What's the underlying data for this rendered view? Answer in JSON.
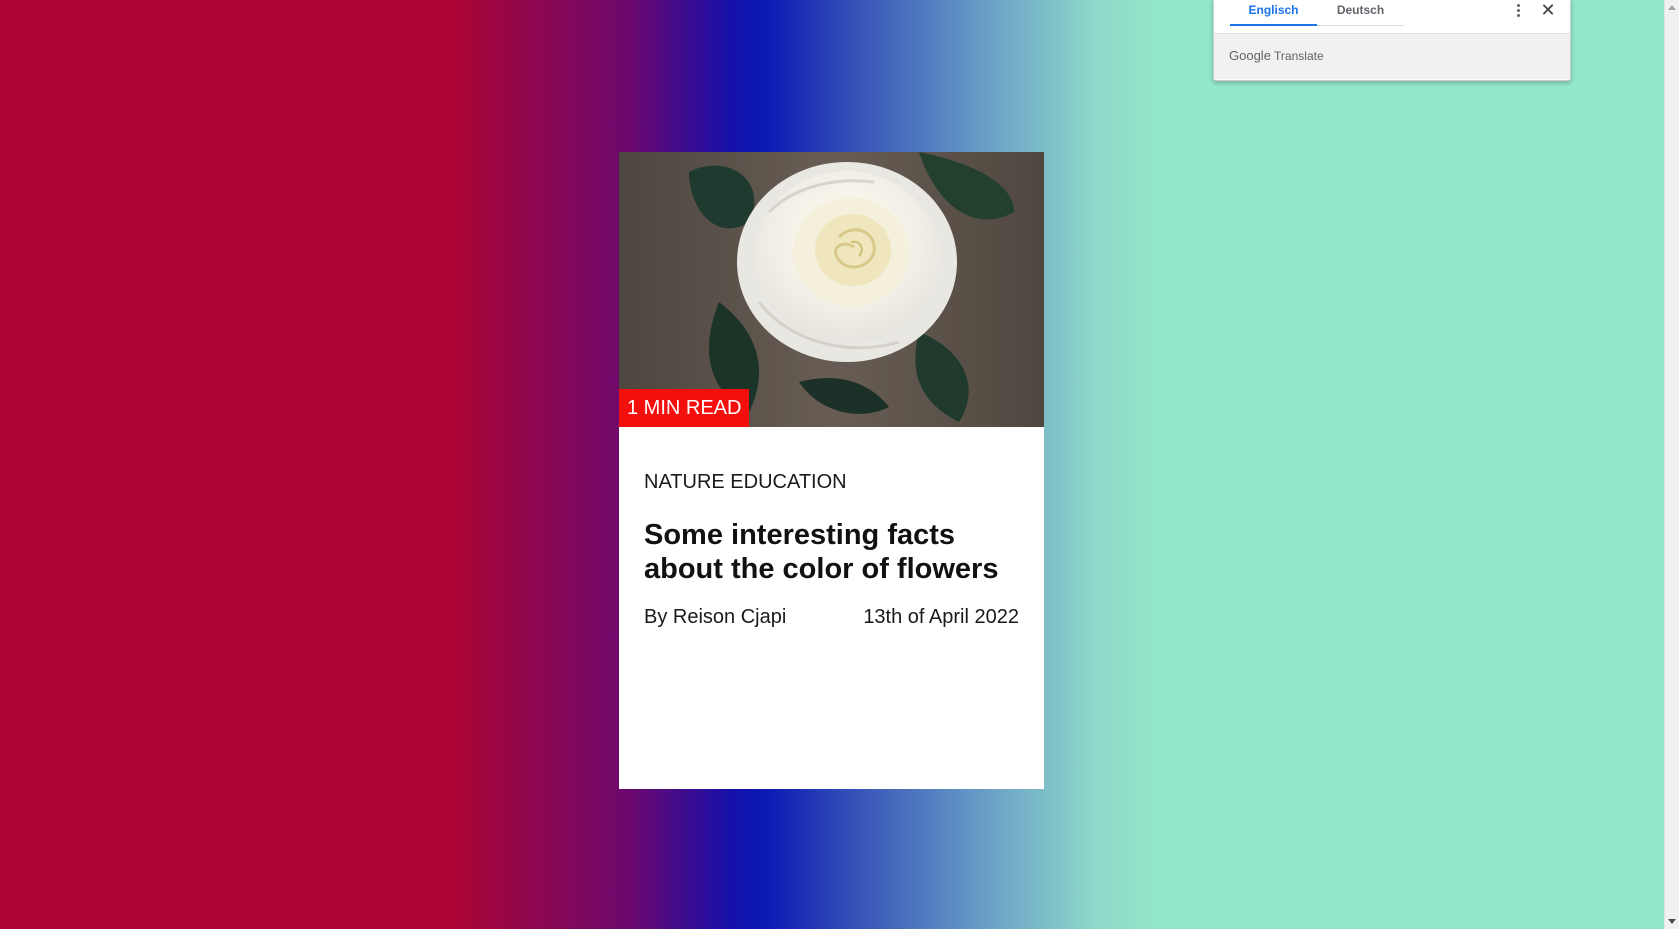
{
  "card": {
    "badge": "1 MIN READ",
    "category": "NATURE EDUCATION",
    "title": "Some interesting facts about the color of flowers",
    "author": "By Reison Cjapi",
    "date": "13th of April 2022",
    "image_icon": "white-rose-photo"
  },
  "translate_popup": {
    "tabs": [
      {
        "label": "Englisch",
        "active": true
      },
      {
        "label": "Deutsch",
        "active": false
      }
    ],
    "brand_google": "Google",
    "brand_translate": "Translate",
    "menu_icon": "more-vert-icon",
    "close_icon": "close-icon"
  },
  "colors": {
    "badge_bg": "#f30f0c",
    "gradient_left": "#ad0533",
    "gradient_mid": "#0b19b3",
    "gradient_right": "#93e8c9",
    "tab_active": "#1a73e8"
  }
}
